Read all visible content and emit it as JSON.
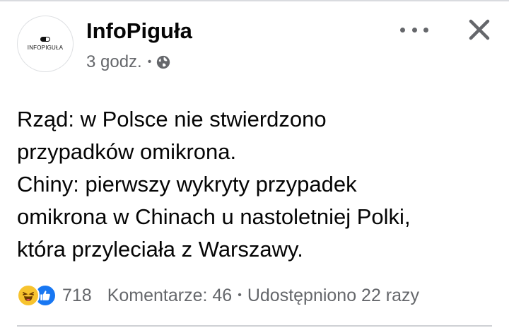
{
  "post": {
    "page_name": "InfoPiguła",
    "avatar_text": "INFOPIGUŁA",
    "time": "3 godz.",
    "separator": "•",
    "audience_icon": "globe-icon",
    "text_lines": [
      "Rząd: w Polsce nie stwierdzono",
      "przypadków omikrona.",
      "Chiny: pierwszy wykryty przypadek",
      "omikrona w Chinach u nastoletniej Polki,",
      "która przyleciała z Warszawy."
    ],
    "reactions": {
      "icons": [
        "haha-icon",
        "like-icon"
      ],
      "count": "718"
    },
    "comments": "Komentarze: 46",
    "separator2": "•",
    "shares": "Udostępniono 22 razy"
  },
  "colors": {
    "text": "#050505",
    "secondary": "#65676b",
    "like_blue": "#1877f2",
    "haha_yellow": "#f7c32e"
  }
}
